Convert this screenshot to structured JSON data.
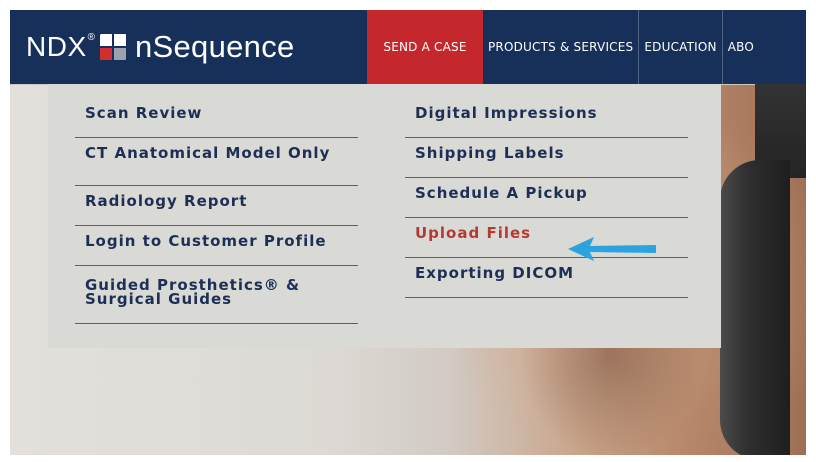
{
  "header": {
    "logo_text": "NDX",
    "logo_reg": "®",
    "brand": "nSequence",
    "nav": [
      {
        "label": "SEND A CASE",
        "active": true
      },
      {
        "label": "PRODUCTS & SERVICES",
        "active": false
      },
      {
        "label": "EDUCATION",
        "active": false
      },
      {
        "label": "ABO",
        "active": false
      }
    ]
  },
  "menu": {
    "left": [
      {
        "label": "Scan Review"
      },
      {
        "label": "CT Anatomical Model Only"
      },
      {
        "label": "Radiology Report"
      },
      {
        "label": "Login to Customer Profile"
      },
      {
        "label": "Guided Prosthetics® & Surgical Guides"
      }
    ],
    "right": [
      {
        "label": "Digital Impressions"
      },
      {
        "label": "Shipping Labels"
      },
      {
        "label": "Schedule A Pickup"
      },
      {
        "label": "Upload Files",
        "highlighted": true
      },
      {
        "label": "Exporting DICOM"
      }
    ]
  },
  "colors": {
    "header_bg": "#17305a",
    "active_nav_bg": "#c5282c",
    "menu_text": "#1d2f55",
    "highlight_text": "#b43a33",
    "divider": "#b83a3a",
    "arrow": "#2aa3de"
  },
  "icons": {
    "logo": "ndx-cross-logo-icon",
    "pointer": "left-arrow-icon"
  }
}
